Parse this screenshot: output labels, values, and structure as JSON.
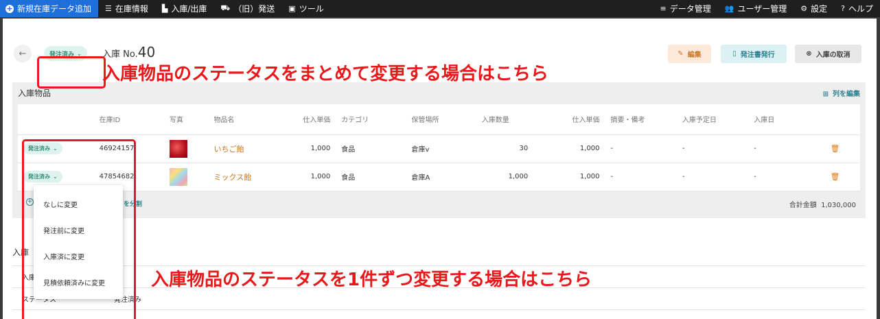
{
  "nav": {
    "new_label": "新規在庫データ追加",
    "stock_info": "在庫情報",
    "in_out": "入庫/出庫",
    "old_shipping": "（旧）発送",
    "tools": "ツール",
    "data_mgmt": "データ管理",
    "user_mgmt": "ユーザー管理",
    "settings": "設定",
    "help": "ヘルプ"
  },
  "header": {
    "status": "発注済み",
    "title_prefix": "入庫 No.",
    "title_number": "40",
    "edit_label": "編集",
    "order_label": "発注書発行",
    "cancel_label": "入庫の取消"
  },
  "annotations": {
    "top": "入庫物品のステータスをまとめて変更する場合はこちら",
    "bottom": "入庫物品のステータスを1件ずつ変更する場合はこちら"
  },
  "items_panel": {
    "title": "入庫物品",
    "column_edit": "列を編集",
    "columns": [
      "",
      "在庫ID",
      "写真",
      "物品名",
      "仕入単価",
      "カテゴリ",
      "保管場所",
      "入庫数量",
      "仕入単価",
      "摘要・備考",
      "入庫予定日",
      "入庫日",
      ""
    ],
    "rows": [
      {
        "status": "発注済み",
        "id": "46924157",
        "name": "いちご飴",
        "unit_price": "1,000",
        "category": "食品",
        "location": "倉庫v",
        "qty": "30",
        "price": "1,000",
        "note": "-",
        "scheduled": "-",
        "date": "-"
      },
      {
        "status": "発注済み",
        "id": "47854682",
        "name": "ミックス飴",
        "unit_price": "1,000",
        "category": "食品",
        "location": "倉庫A",
        "qty": "1,000",
        "price": "1,000",
        "note": "-",
        "scheduled": "-",
        "date": "-"
      }
    ],
    "split_label": "を分割",
    "total_label": "合計金額",
    "total_value": "1,030,000"
  },
  "info": {
    "title": "入庫",
    "row1_key": "入庫",
    "row1_value": "40",
    "row2_key": "ステータス",
    "row2_value": "発注済み"
  },
  "dropdown": {
    "options": [
      "なしに変更",
      "発注前に変更",
      "入庫済に変更",
      "見積依頼済みに変更"
    ]
  },
  "colors": {
    "accent_blue": "#1e6fd9",
    "status_green_bg": "#dff3ee",
    "status_green_text": "#2a8c74",
    "annotation_red": "#e8181b",
    "item_name_orange": "#c9761c"
  }
}
